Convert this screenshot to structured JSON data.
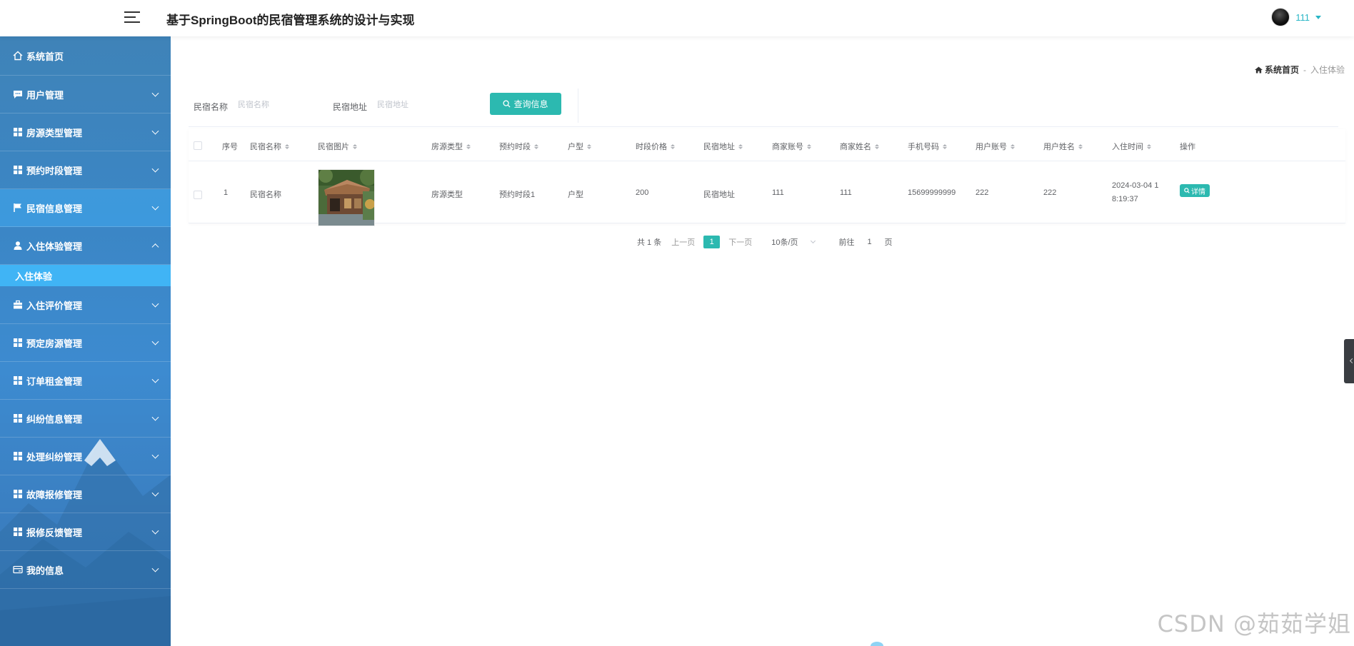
{
  "header": {
    "title": "基于SpringBoot的民宿管理系统的设计与实现",
    "user_name": "111"
  },
  "sidebar": {
    "items": [
      {
        "label": "系统首页",
        "icon": "home-icon"
      },
      {
        "label": "用户管理",
        "icon": "chat-icon"
      },
      {
        "label": "房源类型管理",
        "icon": "grid-icon"
      },
      {
        "label": "预约时段管理",
        "icon": "grid-icon"
      },
      {
        "label": "民宿信息管理",
        "icon": "flag-icon"
      },
      {
        "label": "入住体验管理",
        "icon": "user-icon",
        "expanded": true
      },
      {
        "label": "入住评价管理",
        "icon": "briefcase-icon"
      },
      {
        "label": "预定房源管理",
        "icon": "grid-icon"
      },
      {
        "label": "订单租金管理",
        "icon": "grid-icon"
      },
      {
        "label": "纠纷信息管理",
        "icon": "grid-icon"
      },
      {
        "label": "处理纠纷管理",
        "icon": "grid-icon"
      },
      {
        "label": "故障报修管理",
        "icon": "grid-icon"
      },
      {
        "label": "报修反馈管理",
        "icon": "grid-icon"
      },
      {
        "label": "我的信息",
        "icon": "card-icon"
      }
    ],
    "submenu": {
      "label": "入住体验"
    }
  },
  "breadcrumb": {
    "home": "系统首页",
    "separator": "-",
    "current": "入住体验"
  },
  "search": {
    "name_label": "民宿名称",
    "name_placeholder": "民宿名称",
    "address_label": "民宿地址",
    "address_placeholder": "民宿地址",
    "button_label": "查询信息"
  },
  "table": {
    "columns": [
      "序号",
      "民宿名称",
      "民宿图片",
      "房源类型",
      "预约时段",
      "户型",
      "时段价格",
      "民宿地址",
      "商家账号",
      "商家姓名",
      "手机号码",
      "用户账号",
      "用户姓名",
      "入住时间",
      "操作"
    ],
    "rows": [
      {
        "index": "1",
        "name": "民宿名称",
        "room_type": "房源类型",
        "slot": "预约时段1",
        "layout": "户型",
        "price": "200",
        "address": "民宿地址",
        "merchant_account": "111",
        "merchant_name": "111",
        "phone": "15699999999",
        "user_account": "222",
        "user_name": "222",
        "checkin_time_line1": "2024-03-04 1",
        "checkin_time_line2": "8:19:37",
        "action": "详情"
      }
    ]
  },
  "pagination": {
    "total": "共 1 条",
    "prev": "上一页",
    "current": "1",
    "next": "下一页",
    "page_size": "10条/页",
    "goto_label": "前往",
    "goto_value": "1",
    "page_unit": "页"
  },
  "watermark": "CSDN @茹茹学姐",
  "colors": {
    "accent": "#2cb9b0",
    "sidebar": "#3b86c5",
    "submenu": "#40b4f5"
  }
}
